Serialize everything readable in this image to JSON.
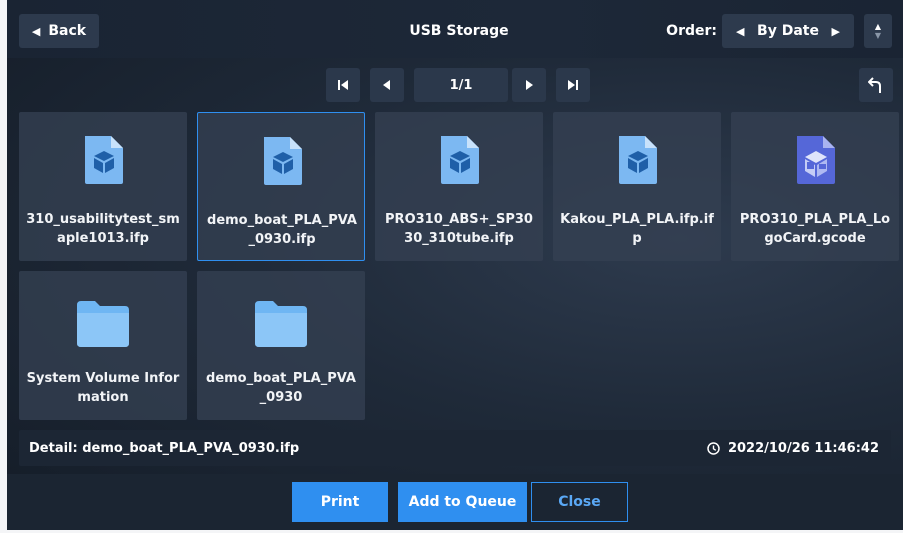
{
  "header": {
    "back_label": "Back",
    "title": "USB Storage",
    "order_label": "Order:",
    "order_value": "By Date"
  },
  "pager": {
    "page": "1/1"
  },
  "files": [
    {
      "name": "310_usabilitytest_smaple1013.ifp",
      "type": "ifp-file"
    },
    {
      "name": "demo_boat_PLA_PVA_0930.ifp",
      "type": "ifp-file",
      "selected": true
    },
    {
      "name": "PRO310_ABS+_SP3030_310tube.ifp",
      "type": "ifp-file"
    },
    {
      "name": "Kakou_PLA_PLA.ifp.ifp",
      "type": "ifp-file"
    },
    {
      "name": "PRO310_PLA_PLA_LogoCard.gcode",
      "type": "gcode-file"
    },
    {
      "name": "System Volume Information",
      "type": "folder"
    },
    {
      "name": "demo_boat_PLA_PVA_0930",
      "type": "folder"
    }
  ],
  "detail": {
    "text": "Detail: demo_boat_PLA_PVA_0930.ifp",
    "timestamp": "2022/10/26 11:46:42"
  },
  "actions": {
    "print": "Print",
    "add_to_queue": "Add to Queue",
    "close": "Close"
  },
  "colors": {
    "accent": "#2f8ff0",
    "file_icon": "#7cb8f2",
    "gcode_icon": "#5567d8",
    "folder_icon": "#6fb6f3"
  }
}
